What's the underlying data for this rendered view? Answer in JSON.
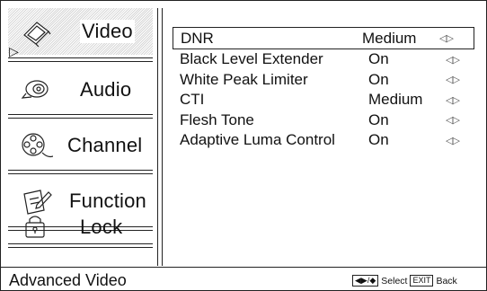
{
  "sidebar": {
    "items": [
      {
        "label": "Video",
        "icon": "tv-icon",
        "selected": true
      },
      {
        "label": "Audio",
        "icon": "speaker-icon",
        "selected": false
      },
      {
        "label": "Channel",
        "icon": "film-reel-icon",
        "selected": false
      },
      {
        "label": "Function",
        "icon": "pencil-paper-icon",
        "selected": false
      },
      {
        "label": "Lock",
        "icon": "lock-icon",
        "selected": false
      }
    ]
  },
  "settings": [
    {
      "name": "DNR",
      "value": "Medium"
    },
    {
      "name": "Black Level Extender",
      "value": "On"
    },
    {
      "name": "White Peak Limiter",
      "value": "On"
    },
    {
      "name": "CTI",
      "value": "Medium"
    },
    {
      "name": "Flesh Tone",
      "value": "On"
    },
    {
      "name": "Adaptive Luma Control",
      "value": "On"
    }
  ],
  "footer": {
    "title": "Advanced Video",
    "nav_keys": "◀▶/◆",
    "select_label": "Select",
    "exit_key": "EXIT",
    "back_label": "Back"
  }
}
